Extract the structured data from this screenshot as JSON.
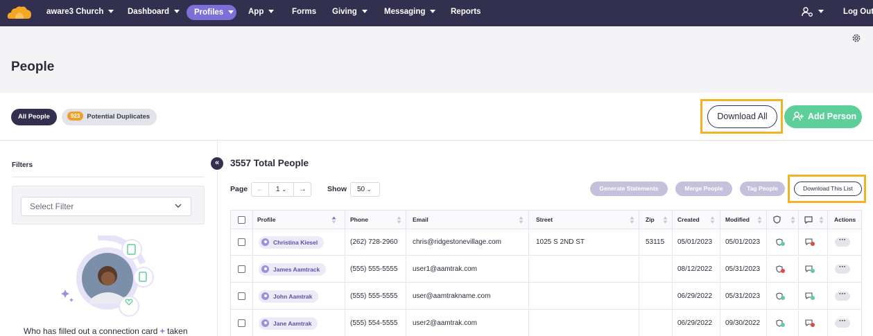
{
  "nav": {
    "church": "aware3 Church",
    "items": [
      "Dashboard",
      "Profiles",
      "App",
      "Forms",
      "Giving",
      "Messaging",
      "Reports"
    ],
    "logout": "Log Out"
  },
  "page": {
    "title": "People"
  },
  "tabs": {
    "all": "All People",
    "dup_count": "923",
    "dup_label": "Potential Duplicates"
  },
  "actions": {
    "download_all": "Download All",
    "add_person": "Add Person"
  },
  "sidebar": {
    "filters_label": "Filters",
    "select_placeholder": "Select Filter",
    "promo_text_a": "Who has filled out a connection card",
    "promo_plus": "+",
    "promo_text_b": "taken"
  },
  "main": {
    "total": "3557 Total People",
    "page_label": "Page",
    "page_value": "1",
    "show_label": "Show",
    "show_value": "50",
    "generate_statements": "Generate Statements",
    "merge_people": "Merge People",
    "tag_people": "Tag People",
    "download_list": "Download This List"
  },
  "table": {
    "headers": [
      "Profile",
      "Phone",
      "Email",
      "Street",
      "Zip",
      "Created",
      "Modified",
      "Actions"
    ],
    "rows": [
      {
        "name": "Christina Kiesel",
        "phone": "(262) 728-2960",
        "email": "chris@ridgestonevillage.com",
        "street": "1025 S 2ND ST",
        "zip": "53115",
        "created": "05/01/2023",
        "modified": "05/01/2023"
      },
      {
        "name": "James Aamtrack",
        "phone": "(555) 555-5555",
        "email": "user1@aamtrak.com",
        "street": "",
        "zip": "",
        "created": "08/12/2022",
        "modified": "05/31/2023"
      },
      {
        "name": "John Aamtrak",
        "phone": "(555) 555-5555",
        "email": "user@aamtrakname.com",
        "street": "",
        "zip": "",
        "created": "06/29/2022",
        "modified": "05/31/2023"
      },
      {
        "name": "Jane Aamtrak",
        "phone": "(555) 554-5555",
        "email": "user2@aamtrak.com",
        "street": "",
        "zip": "",
        "created": "06/29/2022",
        "modified": "09/30/2022"
      }
    ]
  },
  "colors": {
    "nav_bg": "#33304f",
    "accent": "#7b6fd8",
    "green": "#5ecf9a",
    "highlight": "#f0b323",
    "badge": "#f0a02a"
  },
  "icons": [
    "logo-cloud",
    "caret-down-icon",
    "user-settings-icon",
    "gear-icon",
    "add-user-icon",
    "chevron-down-icon",
    "collapse-icon",
    "sort-icon",
    "shield-icon",
    "message-icon",
    "more-icon"
  ]
}
